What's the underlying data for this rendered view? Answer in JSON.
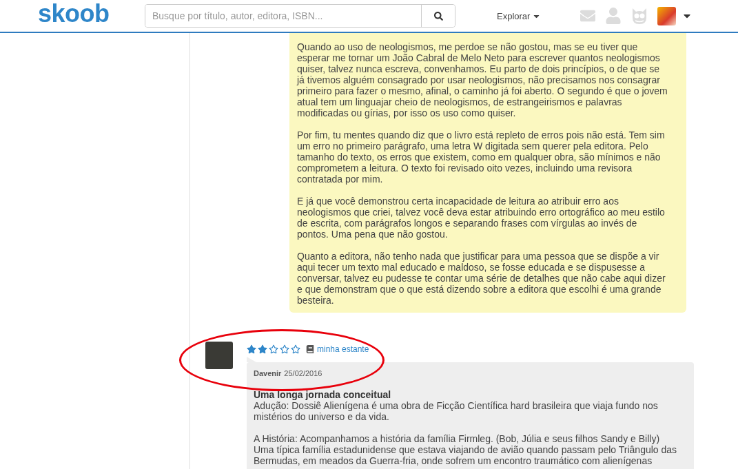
{
  "header": {
    "logo": "skoob",
    "search": {
      "placeholder": "Busque por título, autor, editora, ISBN..."
    },
    "explore": "Explorar"
  },
  "reply": {
    "paragraphs": [
      "Quando ao uso de neologismos, me perdoe se não gostou, mas se eu tiver que esperar me tornar um João Cabral de Melo Neto para escrever quantos neologismos quiser, talvez nunca escreva, convenhamos. Eu parto de dois princípios, o de que se já tivemos alguém consagrado por usar neologismos, não precisamos nos consagrar primeiro para fazer o mesmo, afinal, o caminho já foi aberto. O segundo é que o jovem atual tem um linguajar cheio de neologismos, de estrangeirismos e palavras modificadas ou gírias, por isso os uso como quiser.",
      "Por fim, tu mentes quando diz que o livro está repleto de erros pois não está. Tem sim um erro no primeiro parágrafo, uma letra W digitada sem querer pela editora. Pelo tamanho do texto, os erros que existem, como em qualquer obra, são mínimos e não comprometem a leitura. O texto foi revisado oito vezes, incluindo uma revisora contratada por mim.",
      "E já que você demonstrou certa incapacidade de leitura ao atribuir erro aos neologismos que criei, talvez você deva estar atribuindo erro ortográfico ao meu estilo de escrita, com parágrafos longos e separando frases com vírgulas ao invés de pontos. Uma pena que não gostou.",
      "Quanto a editora, não tenho nada que justificar para uma pessoa que se dispõe a vir aqui tecer um texto mal educado e maldoso, se fosse educada e se dispusesse a conversar, talvez eu pudesse te contar uma série de detalhes que não cabe aqui dizer e que demonstram que o que está dizendo sobre a editora que escolhi é uma grande besteira."
    ]
  },
  "review": {
    "stars": 2,
    "shelf_link": "minha estante",
    "author": "Davenir",
    "date": "25/02/2016",
    "title": "Uma longa jornada conceitual",
    "paragraphs": [
      "Adução: Dossiê Alienígena é uma obra de Ficção Científica hard brasileira que viaja fundo nos mistérios do universo e da vida.",
      "A História: Acompanhamos a história da família Firmleg. (Bob, Júlia e seus filhos Sandy e Billy) Uma típica família estadunidense que estava viajando de avião quando passam pelo Triângulo das Bermudas, em meados da Guerra-fria, onde sofrem um encontro traumático com alienígenas"
    ]
  },
  "annotations": [
    {
      "kind": "ellipse"
    }
  ]
}
